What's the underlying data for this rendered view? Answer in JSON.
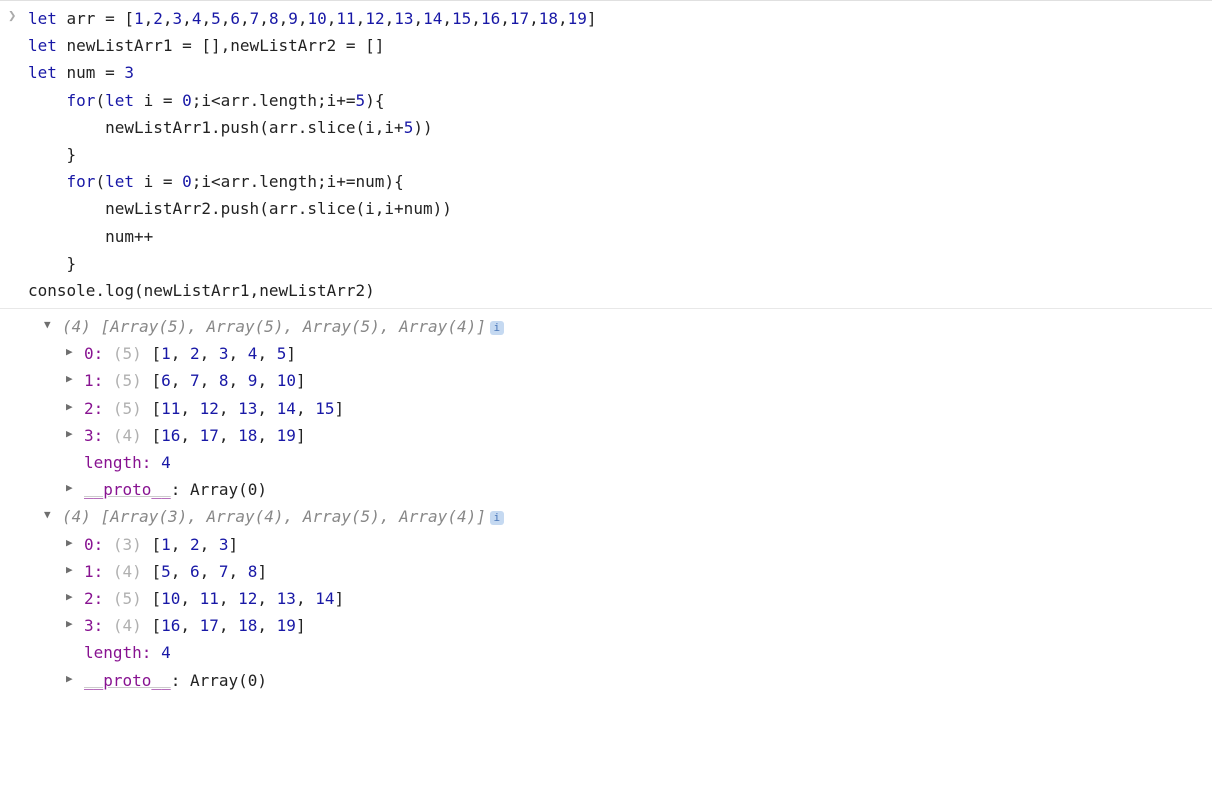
{
  "input": {
    "lines": [
      [
        {
          "t": "let ",
          "c": "kw"
        },
        {
          "t": "arr = ["
        },
        {
          "t": "1",
          "c": "num"
        },
        {
          "t": ","
        },
        {
          "t": "2",
          "c": "num"
        },
        {
          "t": ","
        },
        {
          "t": "3",
          "c": "num"
        },
        {
          "t": ","
        },
        {
          "t": "4",
          "c": "num"
        },
        {
          "t": ","
        },
        {
          "t": "5",
          "c": "num"
        },
        {
          "t": ","
        },
        {
          "t": "6",
          "c": "num"
        },
        {
          "t": ","
        },
        {
          "t": "7",
          "c": "num"
        },
        {
          "t": ","
        },
        {
          "t": "8",
          "c": "num"
        },
        {
          "t": ","
        },
        {
          "t": "9",
          "c": "num"
        },
        {
          "t": ","
        },
        {
          "t": "10",
          "c": "num"
        },
        {
          "t": ","
        },
        {
          "t": "11",
          "c": "num"
        },
        {
          "t": ","
        },
        {
          "t": "12",
          "c": "num"
        },
        {
          "t": ","
        },
        {
          "t": "13",
          "c": "num"
        },
        {
          "t": ","
        },
        {
          "t": "14",
          "c": "num"
        },
        {
          "t": ","
        },
        {
          "t": "15",
          "c": "num"
        },
        {
          "t": ","
        },
        {
          "t": "16",
          "c": "num"
        },
        {
          "t": ","
        },
        {
          "t": "17",
          "c": "num"
        },
        {
          "t": ","
        },
        {
          "t": "18",
          "c": "num"
        },
        {
          "t": ","
        },
        {
          "t": "19",
          "c": "num"
        },
        {
          "t": "]"
        }
      ],
      [
        {
          "t": "let ",
          "c": "kw"
        },
        {
          "t": "newListArr1 = [],newListArr2 = []"
        }
      ],
      [
        {
          "t": "let ",
          "c": "kw"
        },
        {
          "t": "num = "
        },
        {
          "t": "3",
          "c": "num"
        }
      ],
      [
        {
          "t": "    "
        },
        {
          "t": "for",
          "c": "kw"
        },
        {
          "t": "("
        },
        {
          "t": "let ",
          "c": "kw"
        },
        {
          "t": "i = "
        },
        {
          "t": "0",
          "c": "num"
        },
        {
          "t": ";i<arr.length;i+="
        },
        {
          "t": "5",
          "c": "num"
        },
        {
          "t": "){"
        }
      ],
      [
        {
          "t": "        newListArr1.push(arr.slice(i,i+"
        },
        {
          "t": "5",
          "c": "num"
        },
        {
          "t": "))"
        }
      ],
      [
        {
          "t": "    }"
        }
      ],
      [
        {
          "t": "    "
        },
        {
          "t": "for",
          "c": "kw"
        },
        {
          "t": "("
        },
        {
          "t": "let ",
          "c": "kw"
        },
        {
          "t": "i = "
        },
        {
          "t": "0",
          "c": "num"
        },
        {
          "t": ";i<arr.length;i+=num){"
        }
      ],
      [
        {
          "t": "        newListArr2.push(arr.slice(i,i+num))"
        }
      ],
      [
        {
          "t": "        num++"
        }
      ],
      [
        {
          "t": "    }"
        }
      ],
      [
        {
          "t": "console.log(newListArr1,newListArr2)"
        }
      ]
    ]
  },
  "output": {
    "arrays": [
      {
        "summary_count": "(4)",
        "summary_items": "[Array(5), Array(5), Array(5), Array(4)]",
        "rows": [
          {
            "idx": "0:",
            "len": "(5)",
            "vals": [
              "1",
              "2",
              "3",
              "4",
              "5"
            ]
          },
          {
            "idx": "1:",
            "len": "(5)",
            "vals": [
              "6",
              "7",
              "8",
              "9",
              "10"
            ]
          },
          {
            "idx": "2:",
            "len": "(5)",
            "vals": [
              "11",
              "12",
              "13",
              "14",
              "15"
            ]
          },
          {
            "idx": "3:",
            "len": "(4)",
            "vals": [
              "16",
              "17",
              "18",
              "19"
            ]
          }
        ],
        "length_label": "length:",
        "length_value": "4",
        "proto_label": "__proto__",
        "proto_value": ": Array(0)"
      },
      {
        "summary_count": "(4)",
        "summary_items": "[Array(3), Array(4), Array(5), Array(4)]",
        "rows": [
          {
            "idx": "0:",
            "len": "(3)",
            "vals": [
              "1",
              "2",
              "3"
            ]
          },
          {
            "idx": "1:",
            "len": "(4)",
            "vals": [
              "5",
              "6",
              "7",
              "8"
            ]
          },
          {
            "idx": "2:",
            "len": "(5)",
            "vals": [
              "10",
              "11",
              "12",
              "13",
              "14"
            ]
          },
          {
            "idx": "3:",
            "len": "(4)",
            "vals": [
              "16",
              "17",
              "18",
              "19"
            ]
          }
        ],
        "length_label": "length:",
        "length_value": "4",
        "proto_label": "__proto__",
        "proto_value": ": Array(0)"
      }
    ],
    "info_badge": "i"
  }
}
